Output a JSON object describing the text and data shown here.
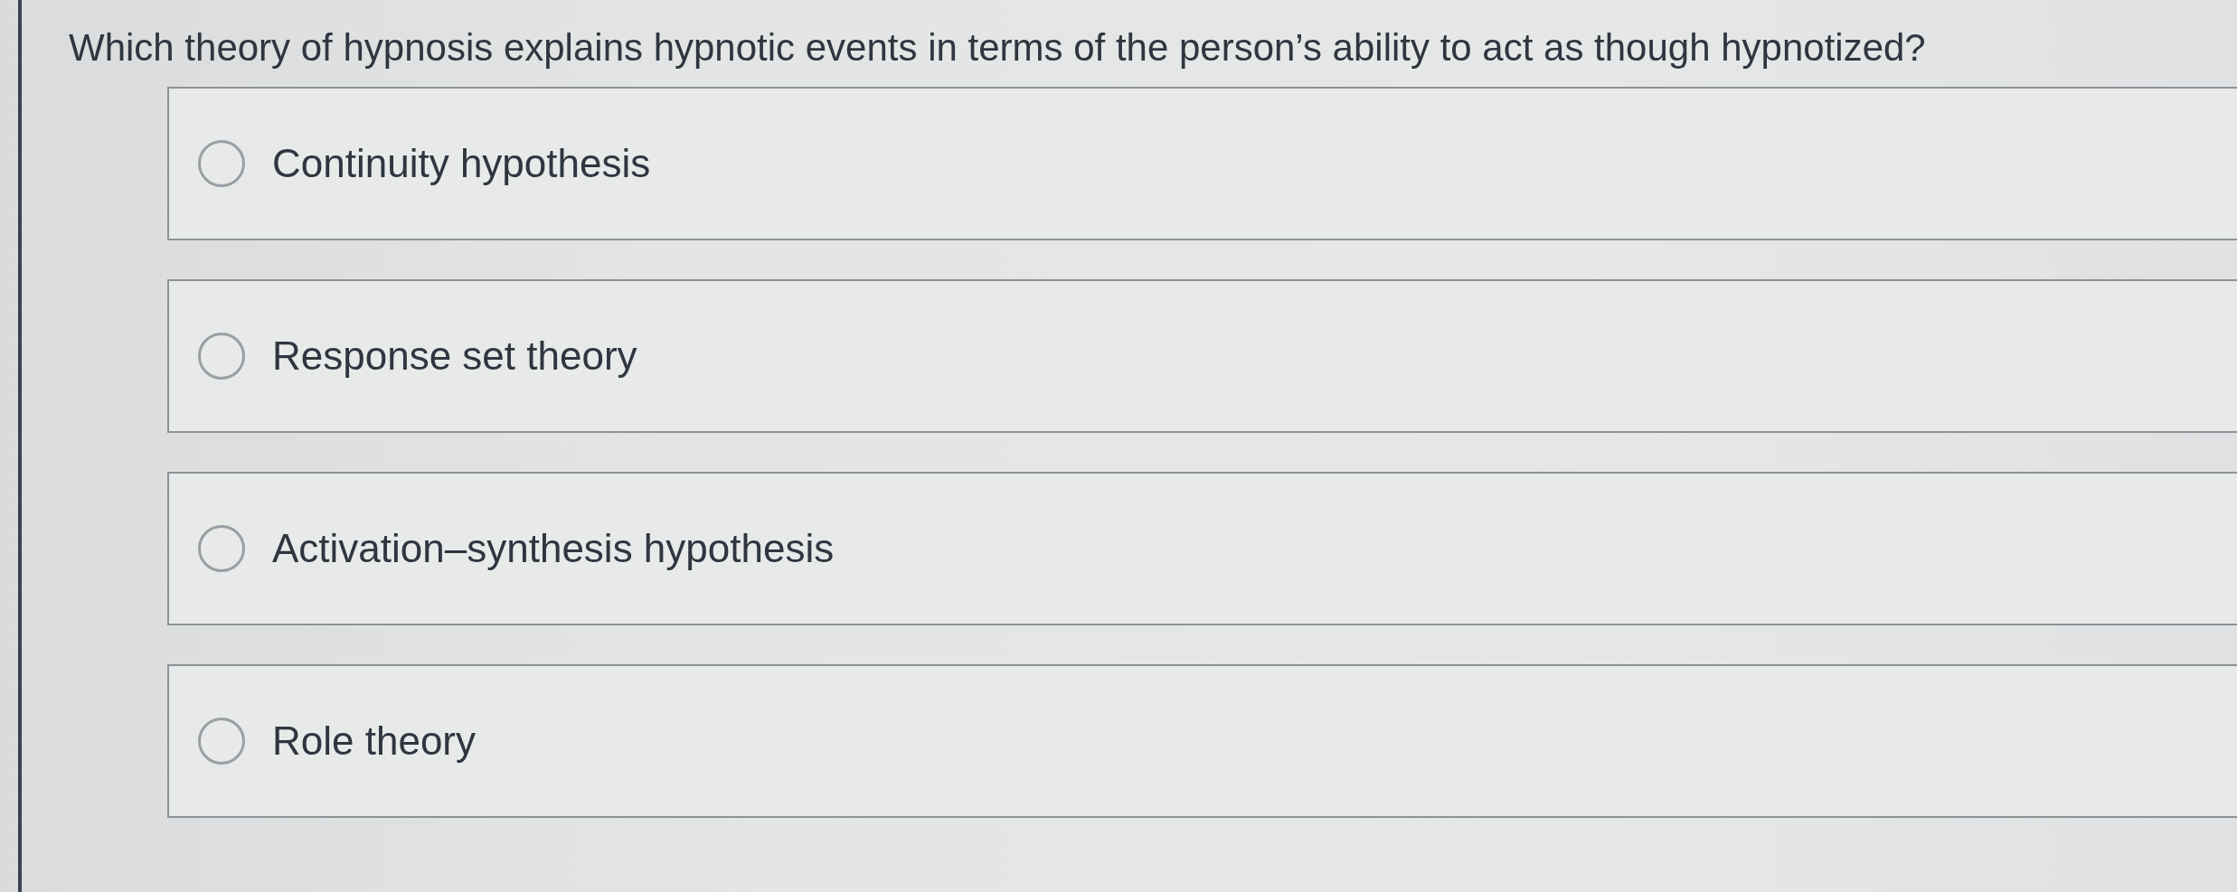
{
  "question": {
    "text": "Which theory of hypnosis explains hypnotic events in terms of the person’s ability to act as though hypnotized?"
  },
  "options": [
    {
      "label": "Continuity hypothesis",
      "selected": false
    },
    {
      "label": "Response set theory",
      "selected": false
    },
    {
      "label": "Activation–synthesis hypothesis",
      "selected": false
    },
    {
      "label": "Role theory",
      "selected": false
    }
  ]
}
